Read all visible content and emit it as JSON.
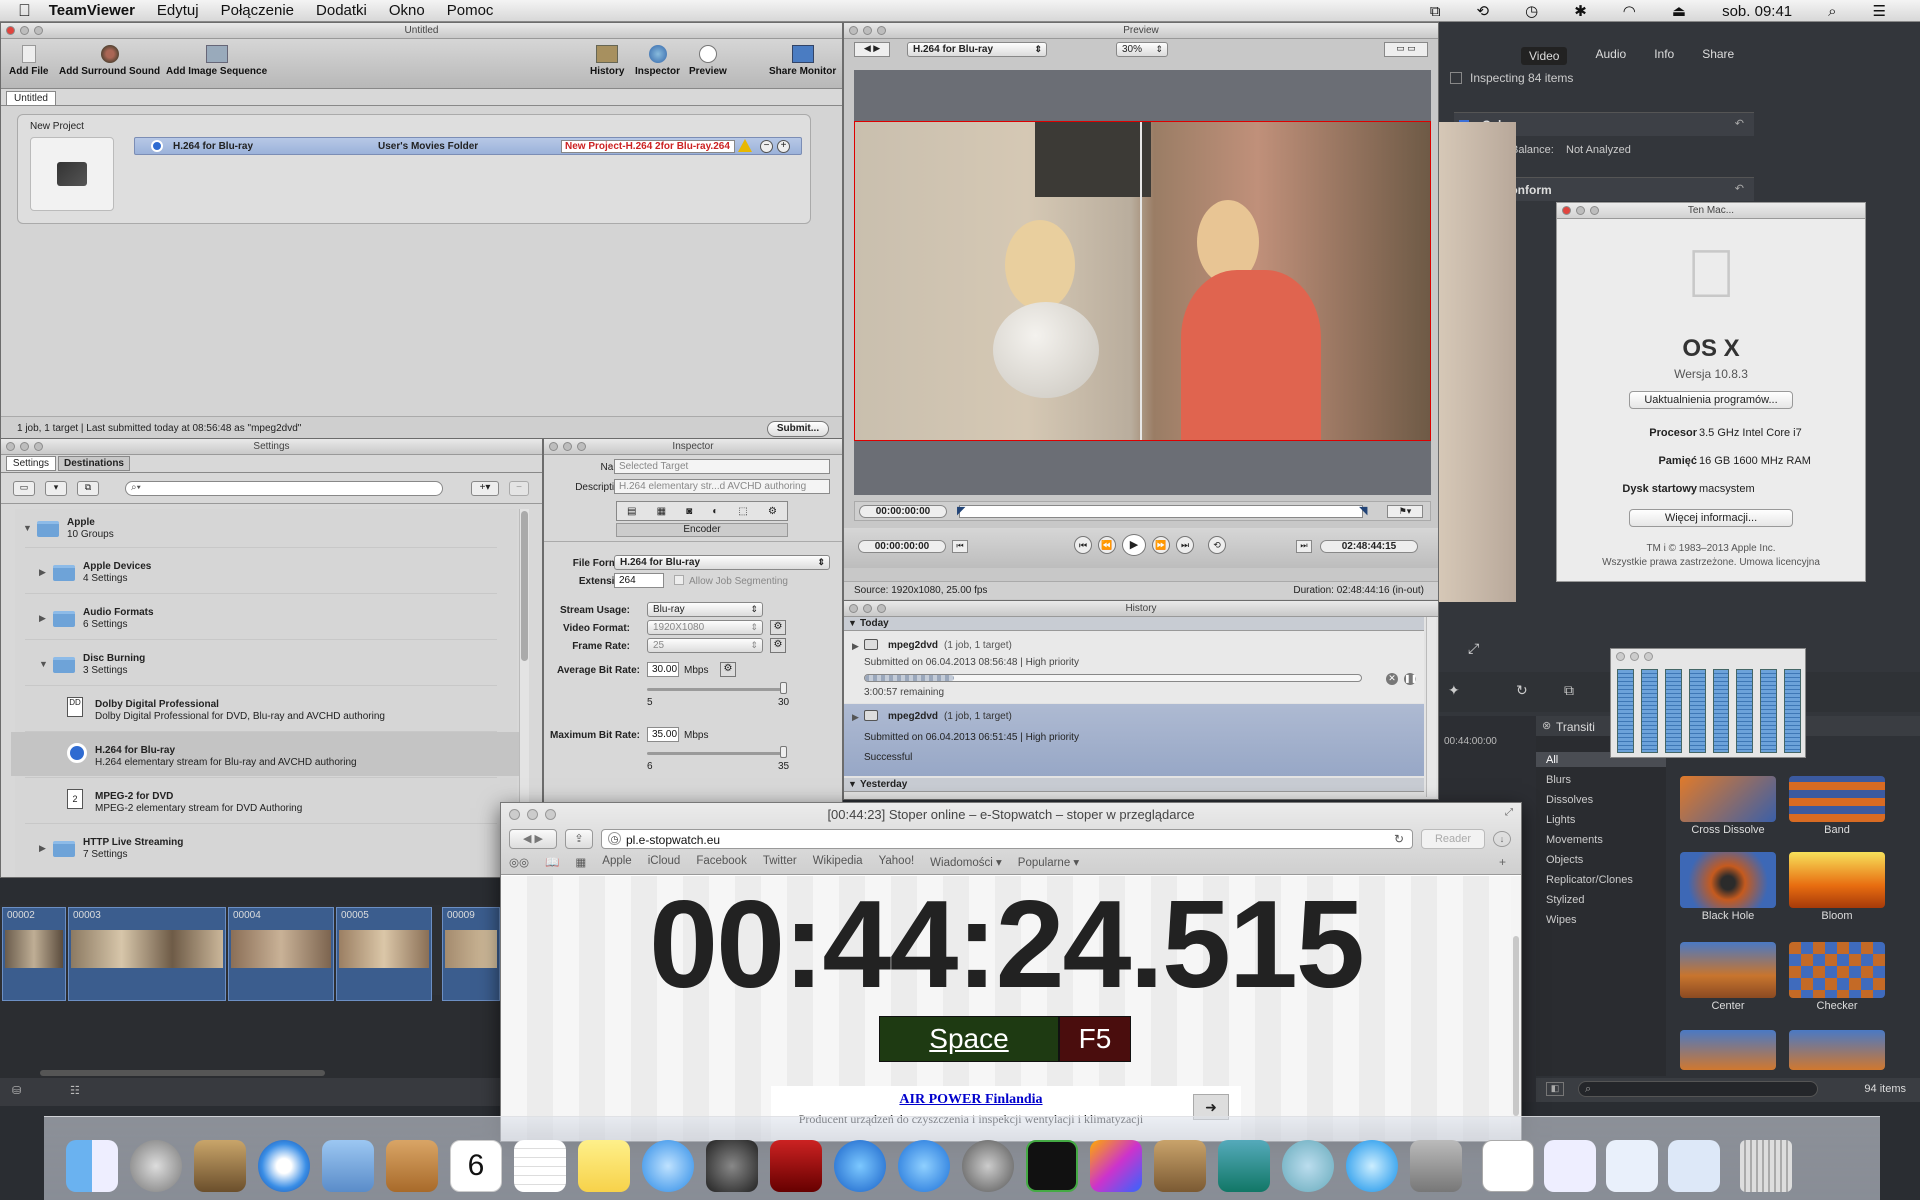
{
  "menubar": {
    "app": "TeamViewer",
    "items": [
      "Edytuj",
      "Połączenie",
      "Dodatki",
      "Okno",
      "Pomoc"
    ],
    "clock": "sob. 09:41"
  },
  "compressor": {
    "title": "Untitled",
    "toolbar": {
      "add_file": "Add File",
      "add_surround": "Add Surround Sound",
      "add_image_seq": "Add Image Sequence",
      "history": "History",
      "inspector": "Inspector",
      "preview": "Preview",
      "share_monitor": "Share Monitor"
    },
    "tab": "Untitled",
    "new_project": "New Project",
    "job": {
      "setting": "H.264 for Blu-ray",
      "destination": "User's Movies Folder",
      "output": "New Project-H.264 2for Blu-ray.264"
    },
    "status": "1 job, 1 target  |  Last submitted today at 08:56:48 as \"mpeg2dvd\"",
    "submit": "Submit..."
  },
  "settings": {
    "title": "Settings",
    "tabs": [
      "Settings",
      "Destinations"
    ],
    "items": [
      {
        "name": "Apple",
        "sub": "10 Groups"
      },
      {
        "name": "Apple Devices",
        "sub": "4 Settings"
      },
      {
        "name": "Audio Formats",
        "sub": "6 Settings"
      },
      {
        "name": "Disc Burning",
        "sub": "3 Settings"
      },
      {
        "name": "Dolby Digital Professional",
        "sub": "Dolby Digital Professional for DVD, Blu-ray and AVCHD authoring"
      },
      {
        "name": "H.264 for Blu-ray",
        "sub": "H.264 elementary stream for Blu-ray and AVCHD authoring"
      },
      {
        "name": "MPEG-2 for DVD",
        "sub": "MPEG-2 elementary stream for DVD Authoring"
      },
      {
        "name": "HTTP Live Streaming",
        "sub": "7 Settings"
      }
    ]
  },
  "inspector": {
    "title": "Inspector",
    "name_label": "Name:",
    "name_value": "Selected Target",
    "desc_label": "Description:",
    "desc_value": "H.264 elementary str...d AVCHD authoring",
    "encoder": "Encoder",
    "file_format_label": "File Format:",
    "file_format": "H.264 for Blu-ray",
    "extension_label": "Extension:",
    "extension": "264",
    "allow_seg": "Allow Job Segmenting",
    "stream_usage_label": "Stream Usage:",
    "stream_usage": "Blu-ray",
    "video_format_label": "Video Format:",
    "video_format": "1920X1080",
    "frame_rate_label": "Frame Rate:",
    "frame_rate": "25",
    "avg_bitrate_label": "Average Bit Rate:",
    "avg_bitrate": "30.00",
    "mbps": "Mbps",
    "avg_min": "5",
    "avg_max": "30",
    "max_bitrate_label": "Maximum Bit Rate:",
    "max_bitrate": "35.00",
    "max_min": "6",
    "max_max": "35"
  },
  "preview": {
    "title": "Preview",
    "setting": "H.264 for Blu-ray",
    "zoom": "30%",
    "tc_in": "00:00:00:00",
    "tc_cur": "00:00:00:00",
    "tc_dur": "02:48:44:15",
    "source": "Source: 1920x1080, 25.00 fps",
    "duration": "Duration: 02:48:44:16 (in-out)"
  },
  "history": {
    "title": "History",
    "today": "Today",
    "yesterday": "Yesterday",
    "jobs": [
      {
        "name": "mpeg2dvd",
        "count": "(1 job, 1 target)",
        "submitted": "Submitted on 06.04.2013 08:56:48  |  High priority",
        "status": "3:00:57 remaining"
      },
      {
        "name": "mpeg2dvd",
        "count": "(1 job, 1 target)",
        "submitted": "Submitted on 06.04.2013 06:51:45  |  High priority",
        "status": "Successful"
      }
    ]
  },
  "fcp": {
    "tabs": [
      "Video",
      "Audio",
      "Info",
      "Share"
    ],
    "inspecting": "Inspecting 84 items",
    "color": "Color",
    "balance_label": "Balance:",
    "balance_value": "Not Analyzed",
    "spatial": "Spatial Conform",
    "transitions_title": "Transiti",
    "categories": [
      "All",
      "Blurs",
      "Dissolves",
      "Lights",
      "Movements",
      "Objects",
      "Replicator/Clones",
      "Stylized",
      "Wipes"
    ],
    "thumbs": [
      "Cross Dissolve",
      "Band",
      "Black Hole",
      "Bloom",
      "Center",
      "Checker"
    ],
    "items_count": "94 items",
    "timecode": "00:44:00:00",
    "clips": [
      "00002",
      "00003",
      "00004",
      "00005",
      "00009"
    ]
  },
  "about": {
    "title": "Ten Mac...",
    "os": "OS X",
    "version": "Wersja 10.8.3",
    "update_btn": "Uaktualnienia programów...",
    "rows": [
      {
        "label": "Procesor",
        "value": "3.5 GHz Intel Core i7"
      },
      {
        "label": "Pamięć",
        "value": "16 GB 1600 MHz RAM"
      },
      {
        "label": "Dysk startowy",
        "value": "macsystem"
      }
    ],
    "more_btn": "Więcej informacji...",
    "copyright1": "TM i © 1983–2013 Apple Inc.",
    "copyright2": "Wszystkie prawa zastrzeżone.  Umowa licencyjna"
  },
  "safari": {
    "title": "[00:44:23] Stoper online – e-Stopwatch – stoper w przeglądarce",
    "url": "pl.e-stopwatch.eu",
    "reader": "Reader",
    "bookmarks": [
      "Apple",
      "iCloud",
      "Facebook",
      "Twitter",
      "Wikipedia",
      "Yahoo!",
      "Wiadomości ▾",
      "Popularne ▾"
    ],
    "time": "00:44:24.515",
    "space_btn": "Space",
    "f5_btn": "F5",
    "ad_title": "AIR POWER Finlandia",
    "ad_text": "Producent urządzeń do czyszczenia i inspekcji wentylacji i klimatyzacji"
  },
  "dock": {
    "calendar_day": "6"
  }
}
